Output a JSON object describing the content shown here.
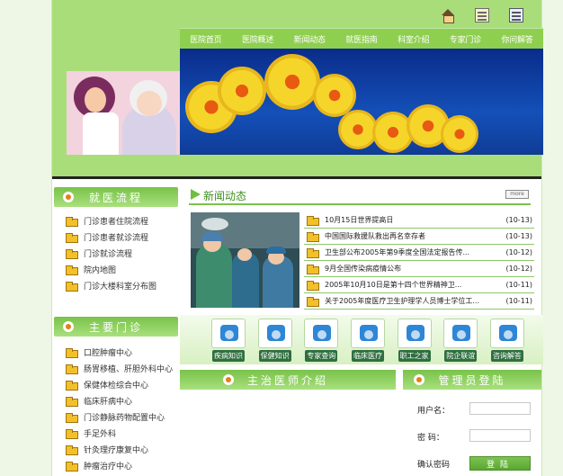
{
  "header": {
    "top_icons": [
      "home-icon",
      "note-icon",
      "document-icon"
    ]
  },
  "nav": {
    "items": [
      "医院首页",
      "医院概述",
      "新闻动态",
      "就医指南",
      "科室介绍",
      "专家门诊",
      "你问解答"
    ]
  },
  "left": {
    "process_title": "就医流程",
    "process_items": [
      "门诊患者住院流程",
      "门诊患者就诊流程",
      "门诊就诊流程",
      "院内地图",
      "门诊大楼科室分布图"
    ],
    "clinics_title": "主要门诊",
    "clinics_items": [
      "口腔肿瘤中心",
      "肠胃移植、肝胆外科中心",
      "保健体检综合中心",
      "临床肝病中心",
      "门诊静脉药物配置中心",
      "手足外科",
      "针灸理疗康复中心",
      "肿瘤治疗中心"
    ]
  },
  "news": {
    "title": "新闻动态",
    "more_label": "more",
    "items": [
      {
        "title": "10月15日世界提高日",
        "date": "(10-13)"
      },
      {
        "title": "中国国际救援队救出再名幸存者",
        "date": "(10-13)"
      },
      {
        "title": "卫生部公布2005年第9季度全国法定报告传...",
        "date": "(10-12)"
      },
      {
        "title": "9月全国传染病疫情公布",
        "date": "(10-12)"
      },
      {
        "title": "2005年10月10日是第十四个世界精神卫...",
        "date": "(10-11)"
      },
      {
        "title": "关于2005年度医疗卫生护理学人员博士学位工...",
        "date": "(10-11)"
      }
    ]
  },
  "quick_links": [
    "疾病知识",
    "保健知识",
    "专家查询",
    "临床医疗",
    "职工之家",
    "院企联谊",
    "咨询解答"
  ],
  "sections": {
    "intro_title": "主治医师介绍",
    "admin_title": "管理员登陆"
  },
  "admin": {
    "username_label": "用户名：",
    "password_label": "密  码：",
    "confirm_label": "确认密码",
    "login_button": "登陆"
  }
}
